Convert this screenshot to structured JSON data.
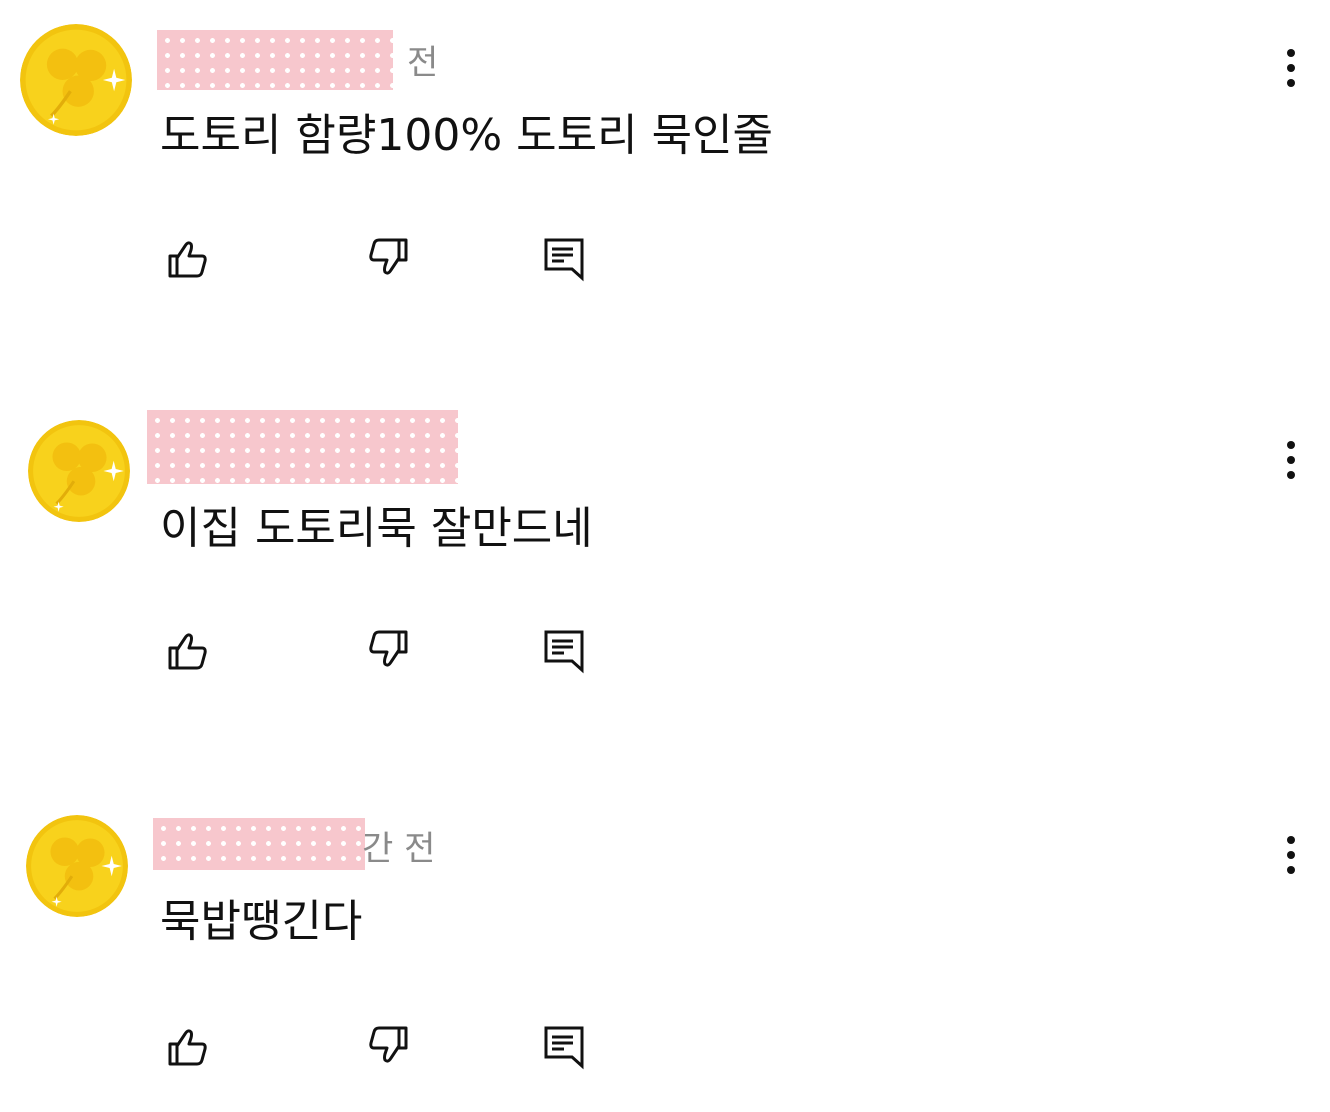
{
  "comments": [
    {
      "time_fragment": "전",
      "text": "도토리 함량100% 도토리 묵인줄"
    },
    {
      "time_fragment": "",
      "text": "이집 도토리묵 잘만드네"
    },
    {
      "time_fragment": "간 전",
      "text": "묵밥땡긴다"
    }
  ],
  "icons": {
    "avatar": "yellow-clover-coin-icon",
    "like": "thumb-up-icon",
    "dislike": "thumb-down-icon",
    "reply": "reply-comment-icon",
    "more": "more-vertical-icon"
  },
  "colors": {
    "avatar_yellow": "#f5cf16",
    "redaction_pink": "#f7c7cd",
    "time_gray": "#8a8a8a",
    "text": "#111111"
  }
}
